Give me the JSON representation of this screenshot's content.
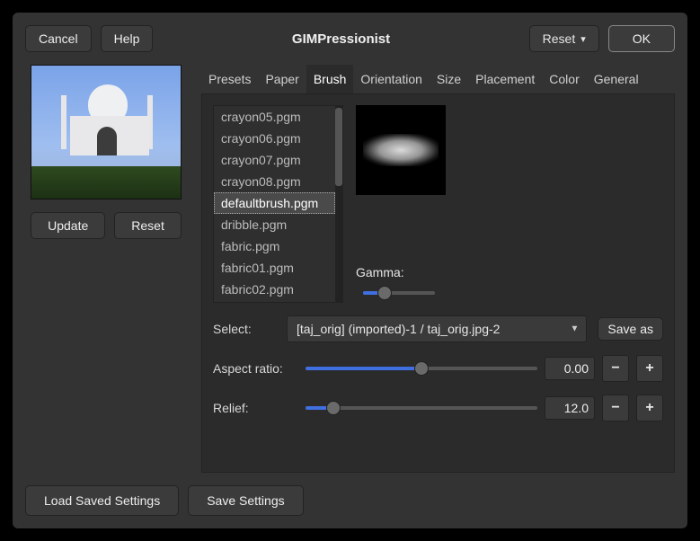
{
  "titlebar": {
    "cancel": "Cancel",
    "help": "Help",
    "title": "GIMPressionist",
    "reset": "Reset",
    "ok": "OK"
  },
  "left": {
    "update": "Update",
    "reset": "Reset"
  },
  "tabs": [
    "Presets",
    "Paper",
    "Brush",
    "Orientation",
    "Size",
    "Placement",
    "Color",
    "General"
  ],
  "active_tab": 2,
  "brush_list": [
    "crayon05.pgm",
    "crayon06.pgm",
    "crayon07.pgm",
    "crayon08.pgm",
    "defaultbrush.pgm",
    "dribble.pgm",
    "fabric.pgm",
    "fabric01.pgm",
    "fabric02.pgm"
  ],
  "brush_selected": 4,
  "gamma": {
    "label": "Gamma:",
    "pos_pct": 30
  },
  "select": {
    "label": "Select:",
    "value": "[taj_orig] (imported)-1 / taj_orig.jpg-2",
    "save_as": "Save as"
  },
  "aspect": {
    "label": "Aspect ratio:",
    "value": "0.00",
    "pos_pct": 50
  },
  "relief": {
    "label": "Relief:",
    "value": "12.0",
    "pos_pct": 12
  },
  "footer": {
    "load": "Load Saved Settings",
    "save": "Save Settings"
  }
}
